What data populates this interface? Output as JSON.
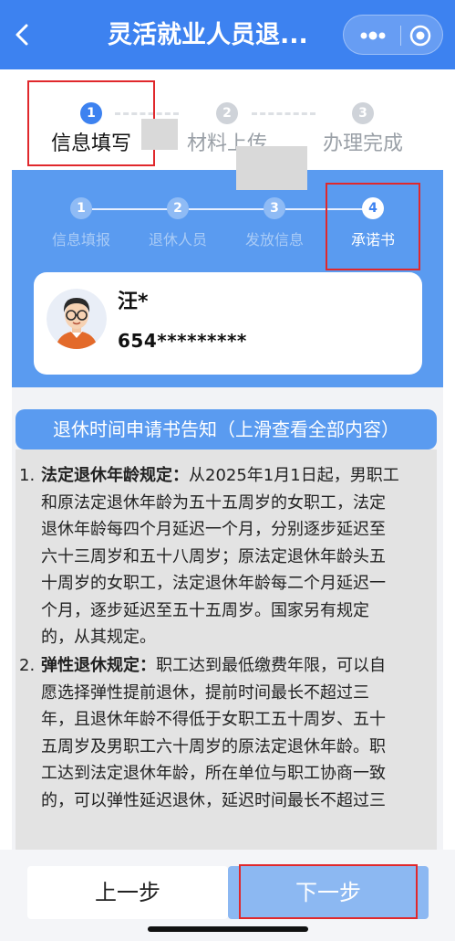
{
  "header": {
    "title": "灵活就业人员退...",
    "back_icon": "chevron-left-icon",
    "more_icon": "more-dots-icon",
    "close_icon": "target-circle-icon",
    "color": "#3d82f0"
  },
  "top_steps": [
    {
      "num": "1",
      "label": "信息填写",
      "active": true
    },
    {
      "num": "2",
      "label": "材料上传",
      "active": false
    },
    {
      "num": "3",
      "label": "办理完成",
      "active": false
    }
  ],
  "inner_steps": [
    {
      "num": "1",
      "label": "信息填报"
    },
    {
      "num": "2",
      "label": "退休人员"
    },
    {
      "num": "3",
      "label": "发放信息"
    },
    {
      "num": "4",
      "label": "承诺书",
      "current": true
    }
  ],
  "person": {
    "name": "汪*",
    "id_number": "654*********"
  },
  "notice": {
    "title": "退休时间申请书告知（上滑查看全部内容）",
    "items": [
      {
        "index": "1.",
        "heading": "法定退休年龄规定：",
        "lines": [
          "从2025年1月1日起，男职工",
          "和原法定退休年龄为五十五周岁的女职工，法定",
          "退休年龄每四个月延迟一个月，分别逐步延迟至",
          "六十三周岁和五十八周岁；原法定退休年龄头五",
          "十周岁的女职工，法定退休年龄每二个月延迟一",
          "个月，逐步延迟至五十五周岁。国家另有规定",
          "的，从其规定。"
        ]
      },
      {
        "index": "2.",
        "heading": "弹性退休规定：",
        "lines": [
          "职工达到最低缴费年限，可以自",
          "愿选择弹性提前退休，提前时间最长不超过三",
          "年，且退休年龄不得低于女职工五十周岁、五十",
          "五周岁及男职工六十周岁的原法定退休年龄。职",
          "工达到法定退休年龄，所在单位与职工协商一致",
          "的，可以弹性延迟退休，延迟时间最长不超过三"
        ]
      }
    ]
  },
  "buttons": {
    "prev": "上一步",
    "next": "下一步"
  }
}
